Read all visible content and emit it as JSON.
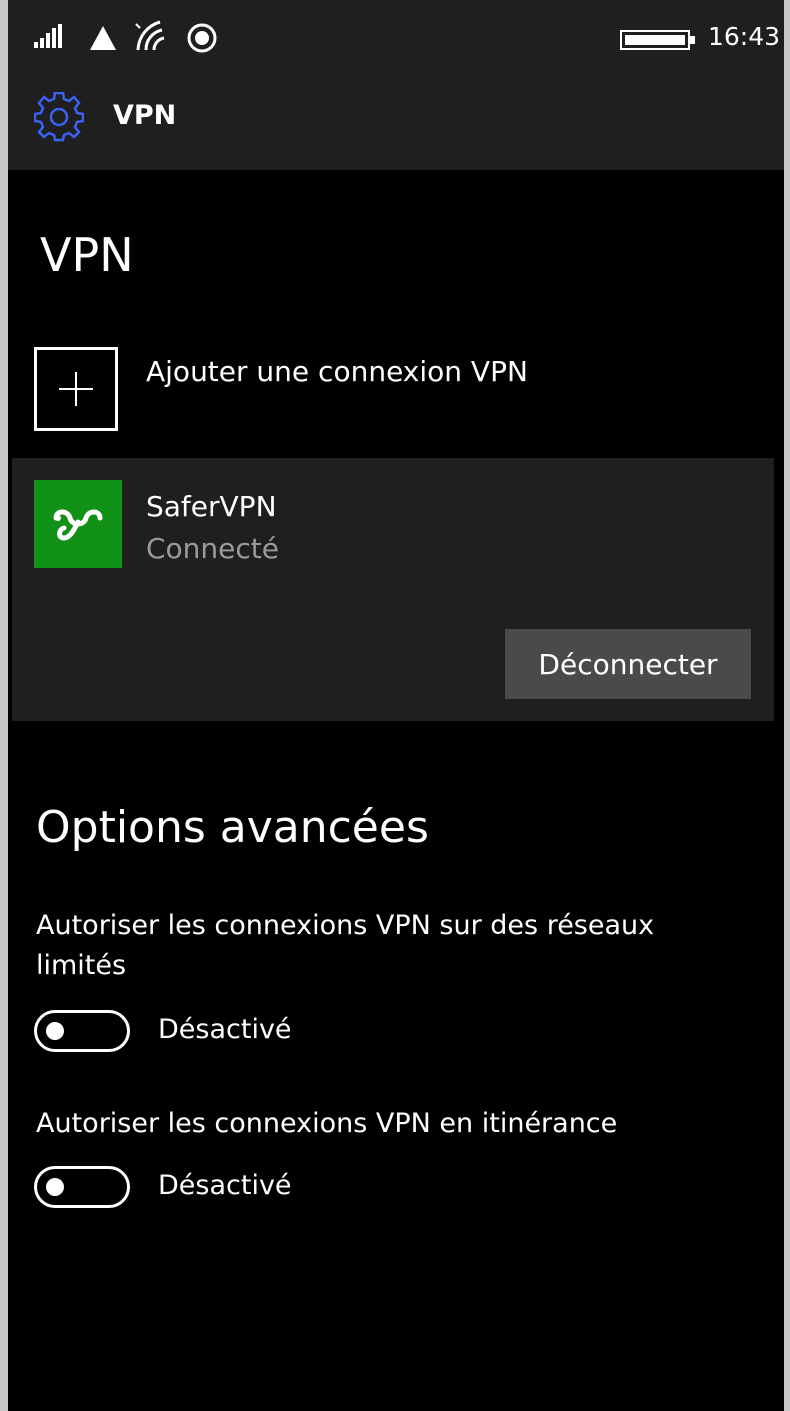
{
  "status_bar": {
    "time": "16:43",
    "icons": [
      "signal-icon",
      "data-triangle-icon",
      "wifi-icon",
      "location-icon",
      "battery-icon"
    ]
  },
  "app_bar": {
    "icon": "gear-icon",
    "title": "VPN"
  },
  "page": {
    "title": "VPN",
    "add_connection_label": "Ajouter une connexion VPN"
  },
  "vpn_connection": {
    "name": "SaferVPN",
    "status": "Connecté",
    "disconnect_label": "Déconnecter",
    "logo_color": "#129118"
  },
  "advanced": {
    "title": "Options avancées",
    "options": [
      {
        "label": "Autoriser les connexions VPN sur des réseaux limités",
        "state": "Désactivé",
        "on": false
      },
      {
        "label": "Autoriser les connexions VPN en itinérance",
        "state": "Désactivé",
        "on": false
      }
    ]
  },
  "colors": {
    "accent": "#3a62f5",
    "background": "#000000",
    "bar": "#1f1f1f",
    "card": "#1f1f1f",
    "button": "#4a4a4a",
    "secondary_text": "#9a9a9a"
  }
}
